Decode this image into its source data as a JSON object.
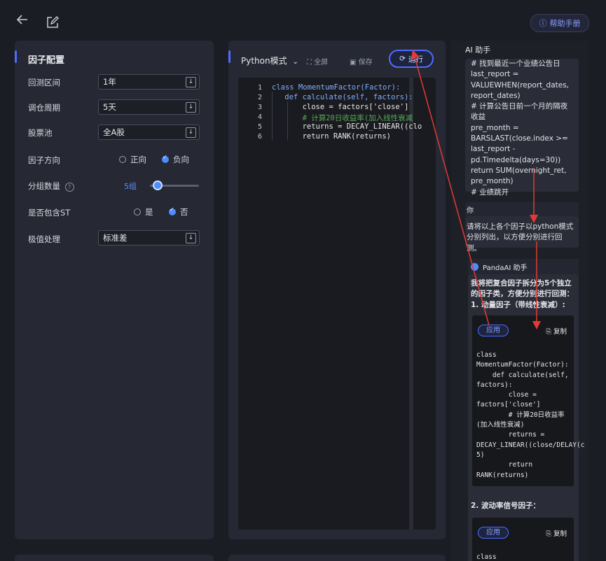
{
  "header": {
    "help_label": "帮助手册"
  },
  "config": {
    "title": "因子配置",
    "rows": [
      {
        "label": "回测区间",
        "value": "1年"
      },
      {
        "label": "调仓周期",
        "value": "5天"
      },
      {
        "label": "股票池",
        "value": "全A股"
      }
    ],
    "direction": {
      "label": "因子方向",
      "options": [
        "正向",
        "负向"
      ],
      "selected": "负向"
    },
    "groups": {
      "label": "分组数量",
      "value": "5组",
      "slider_level": 0.1
    },
    "include_st": {
      "label": "是否包含ST",
      "options": [
        "是",
        "否"
      ],
      "selected": "否"
    },
    "extreme": {
      "label": "极值处理",
      "value": "标准差"
    }
  },
  "editor": {
    "mode": "Python模式",
    "fullscreen": "全屏",
    "save": "保存",
    "run": "运行",
    "line_numbers": [
      "1",
      "2",
      "3",
      "4",
      "5",
      "6"
    ],
    "lines": [
      "class MomentumFactor(Factor):",
      "    def calculate(self, factors):",
      "        close = factors['close']",
      "        # 计算20日收益率(加入线性衰减",
      "        returns = DECAY_LINEAR((clo",
      "        return RANK(returns)"
    ]
  },
  "ai": {
    "title": "AI 助手",
    "prev_text": "# 找到最近一个业绩公告日\nlast_report =\nVALUEWHEN(report_dates,\nreport_dates)\n# 计算公告日前一个月的隔夜收益\npre_month =\nBARSLAST(close.index >=\nlast_report -\npd.Timedelta(days=30))\nreturn SUM(overnight_ret,\npre_month)\n# 业绩跳开",
    "you_label": "你",
    "user_msg": "请将以上各个因子以python模式分别列出，以方便分别进行回测。",
    "assistant_name": "PandaAI 助手",
    "reply_intro": "我将把复合因子拆分为5个独立的因子类，方便分别进行回测：",
    "item1": "1. 动量因子（带线性衰减）:",
    "apply": "应用",
    "copy": "复制",
    "code1": "class\nMomentumFactor(Factor):\n    def calculate(self,\nfactors):\n        close =\nfactors['close']\n        # 计算20日收益率\n(加入线性衰减)\n        returns =\nDECAY_LINEAR((close/DELAY(c\n5)\n        return\nRANK(returns)",
    "item2": "2. 波动率信号因子：",
    "code2_start": "class"
  }
}
